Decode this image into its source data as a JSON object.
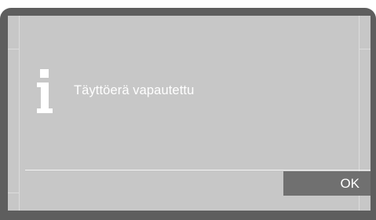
{
  "dialog": {
    "icon": "info-icon",
    "message": "Täyttöerä vapautettu",
    "ok_label": "OK"
  },
  "colors": {
    "frame": "#5e5e5e",
    "screen": "#c7c7c7",
    "button": "#707070",
    "text": "#ffffff"
  }
}
